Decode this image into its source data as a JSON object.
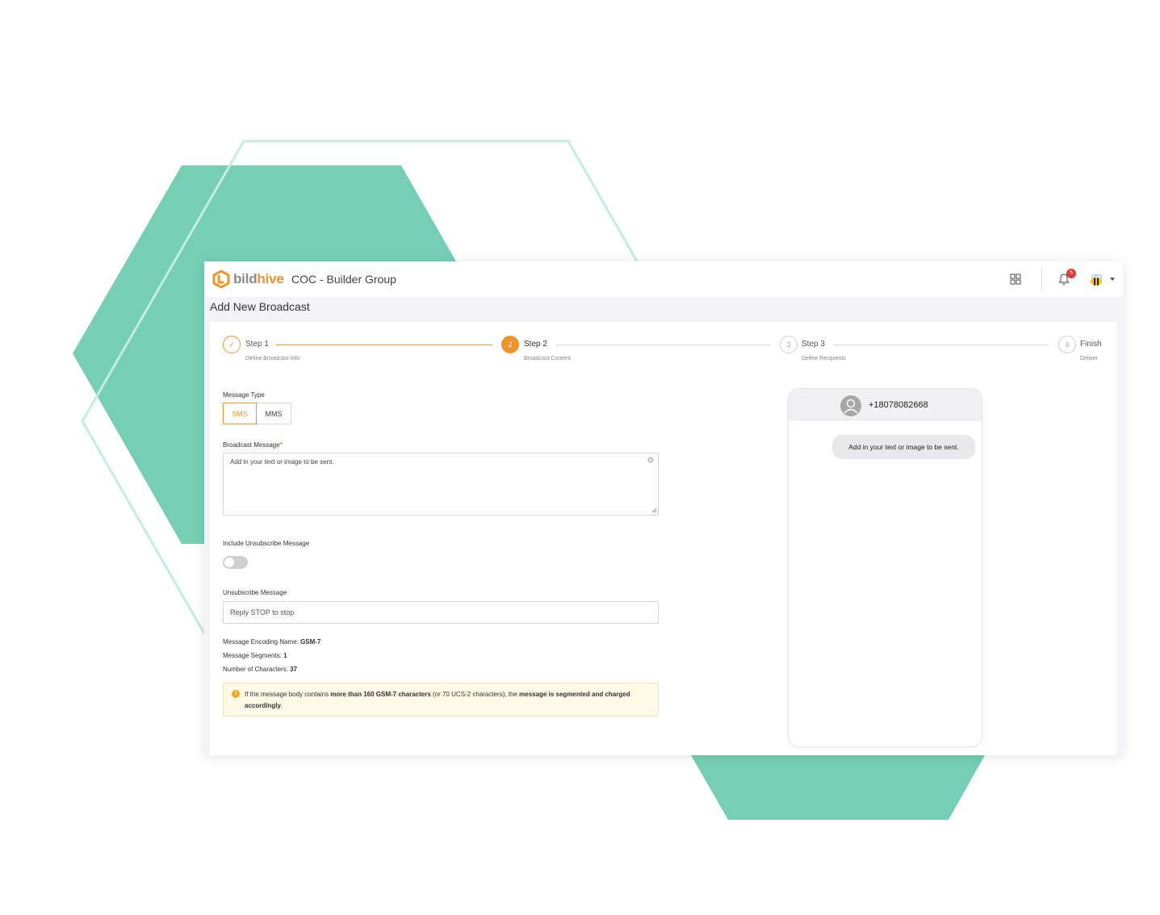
{
  "brand": {
    "logo_part1": "bild",
    "logo_part2": "hive",
    "org_name": "COC - Builder Group",
    "accent_color": "#f0932b",
    "decor_color": "#76cfb5"
  },
  "header": {
    "apps_icon": "grid-apps-icon",
    "notification_icon": "bell-icon",
    "notification_count": "5",
    "avatar_icon": "bee-avatar-icon"
  },
  "page": {
    "title": "Add New Broadcast"
  },
  "stepper": {
    "steps": [
      {
        "number": "✓",
        "label": "Step 1",
        "sub": "Define Broadcast Info",
        "state": "done"
      },
      {
        "number": "2",
        "label": "Step 2",
        "sub": "Broadcast Content",
        "state": "active"
      },
      {
        "number": "3",
        "label": "Step 3",
        "sub": "Define Recipients",
        "state": "pending"
      },
      {
        "number": "4",
        "label": "Finish",
        "sub": "Deliver",
        "state": "pending"
      }
    ]
  },
  "form": {
    "message_type_label": "Message Type",
    "message_type_options": [
      "SMS",
      "MMS"
    ],
    "message_type_selected": "SMS",
    "broadcast_message_label": "Broadcast Message",
    "required_mark": "*",
    "broadcast_message_value": "Add in your text or image to be sent.",
    "include_unsubscribe_label": "Include Unsubscribe Message",
    "include_unsubscribe_on": false,
    "unsubscribe_label": "Unsubscribe Message",
    "unsubscribe_value": "Reply STOP to stop"
  },
  "stats": {
    "encoding_label": "Message Encoding Name: ",
    "encoding_value": "GSM-7",
    "segments_label": "Message Segments: ",
    "segments_value": "1",
    "characters_label": "Number of Characters: ",
    "characters_value": "37"
  },
  "alert": {
    "icon": "!",
    "text_1": "If the message body contains ",
    "bold_1": "more than 160 GSM-7 characters",
    "text_2": " (or 70 UCS-2 characters), the ",
    "bold_2": "message is segmented and charged accordingly",
    "text_3": "."
  },
  "preview": {
    "phone_number": "+18078082668",
    "bubble_text": "Add in your text or image to be sent."
  }
}
